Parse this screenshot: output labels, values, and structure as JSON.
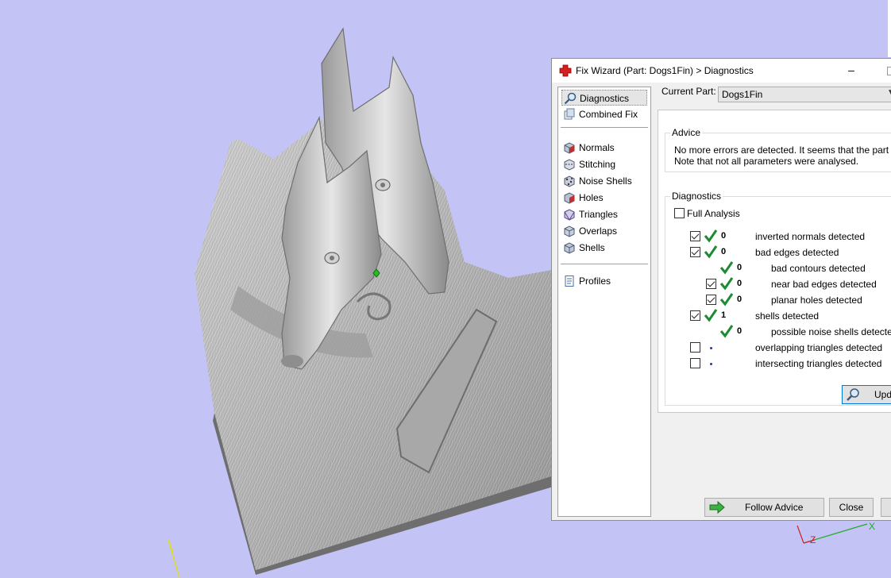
{
  "dialog": {
    "title": "Fix Wizard (Part: Dogs1Fin) > Diagnostics",
    "minimize_glyph": "–"
  },
  "nav": {
    "items": [
      {
        "label": "Diagnostics",
        "icon": "magnifier-icon",
        "selected": true
      },
      {
        "label": "Combined Fix",
        "icon": "combined-fix-icon"
      },
      {
        "label": "Normals",
        "icon": "normals-cube-icon"
      },
      {
        "label": "Stitching",
        "icon": "stitching-icon"
      },
      {
        "label": "Noise Shells",
        "icon": "noise-shells-icon"
      },
      {
        "label": "Holes",
        "icon": "holes-icon"
      },
      {
        "label": "Triangles",
        "icon": "triangles-icon"
      },
      {
        "label": "Overlaps",
        "icon": "overlaps-icon"
      },
      {
        "label": "Shells",
        "icon": "shells-icon"
      },
      {
        "label": "Profiles",
        "icon": "profiles-icon"
      }
    ]
  },
  "current_part": {
    "label": "Current Part:",
    "value": "Dogs1Fin"
  },
  "advice": {
    "title": "Advice",
    "line1": "No more errors are detected. It seems that the part is ok",
    "line2": "Note that not all parameters were analysed."
  },
  "diagnostics": {
    "title": "Diagnostics",
    "full_analysis_label": "Full Analysis",
    "full_analysis_checked": false,
    "rows": [
      {
        "label": "inverted normals detected",
        "count": "0",
        "checked": true,
        "status": "ok"
      },
      {
        "label": "bad edges detected",
        "count": "0",
        "checked": true,
        "status": "ok"
      },
      {
        "label": "bad contours detected",
        "count": "0",
        "checked": null,
        "status": "ok"
      },
      {
        "label": "near bad edges detected",
        "count": "0",
        "checked": true,
        "status": "ok"
      },
      {
        "label": "planar holes detected",
        "count": "0",
        "checked": true,
        "status": "ok"
      },
      {
        "label": "shells detected",
        "count": "1",
        "checked": true,
        "status": "ok"
      },
      {
        "label": "possible noise shells detected",
        "count": "0",
        "checked": null,
        "status": "ok"
      },
      {
        "label": "overlapping triangles detected",
        "count": "",
        "checked": false,
        "status": "pending"
      },
      {
        "label": "intersecting triangles detected",
        "count": "",
        "checked": false,
        "status": "pending"
      }
    ]
  },
  "buttons": {
    "update": "Upda",
    "follow_advice": "Follow Advice",
    "close": "Close"
  },
  "viewport": {
    "background": "#c3c3f6",
    "axis_labels": {
      "x": "X",
      "z": "Z"
    },
    "axis_colors": {
      "x": "#22aa22",
      "z": "#cc2222",
      "y": "#dddd22"
    }
  }
}
